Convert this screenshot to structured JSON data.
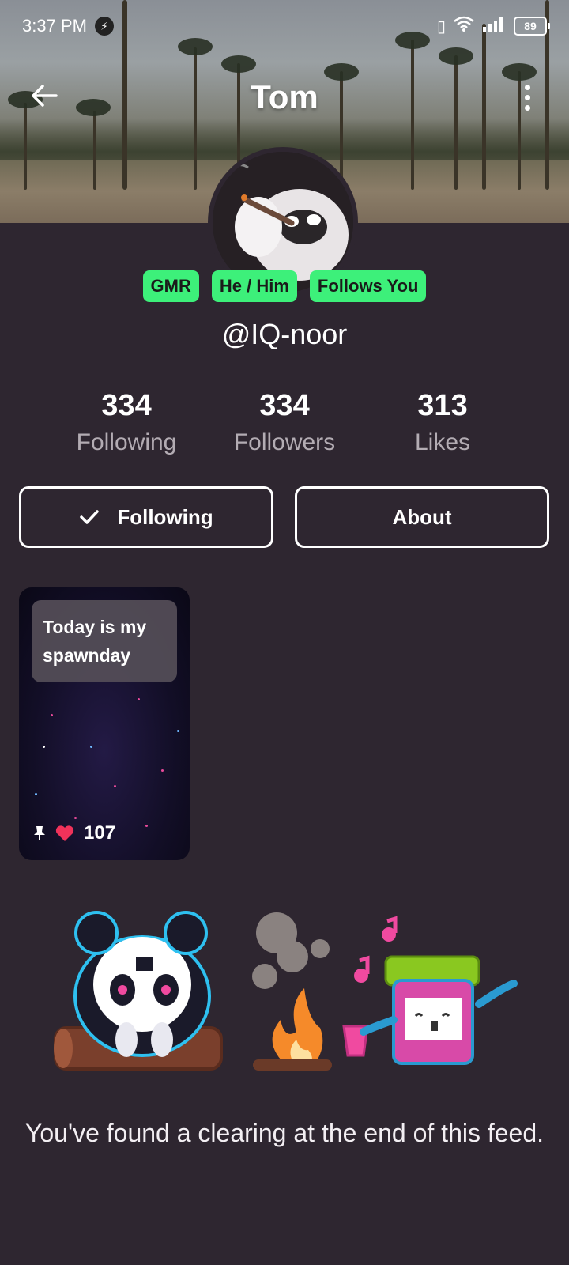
{
  "status_bar": {
    "time": "3:37 PM",
    "battery": "89",
    "icons": [
      "bolt-icon",
      "vibrate-icon",
      "wifi-icon",
      "signal-icon",
      "battery-icon"
    ]
  },
  "header": {
    "title": "Tom"
  },
  "profile": {
    "tags": [
      "GMR",
      "He / Him",
      "Follows You"
    ],
    "handle": "@IQ-noor",
    "stats": {
      "following": {
        "count": "334",
        "label": "Following"
      },
      "followers": {
        "count": "334",
        "label": "Followers"
      },
      "likes": {
        "count": "313",
        "label": "Likes"
      }
    }
  },
  "actions": {
    "following_label": "Following",
    "about_label": "About"
  },
  "posts": [
    {
      "caption": "Today is my spawnday",
      "likes": "107"
    }
  ],
  "feed_end": {
    "message": "You've found a clearing at the end of this feed."
  },
  "colors": {
    "background": "#2e2630",
    "tag_green": "#3df07a",
    "heart": "#f0325a"
  }
}
